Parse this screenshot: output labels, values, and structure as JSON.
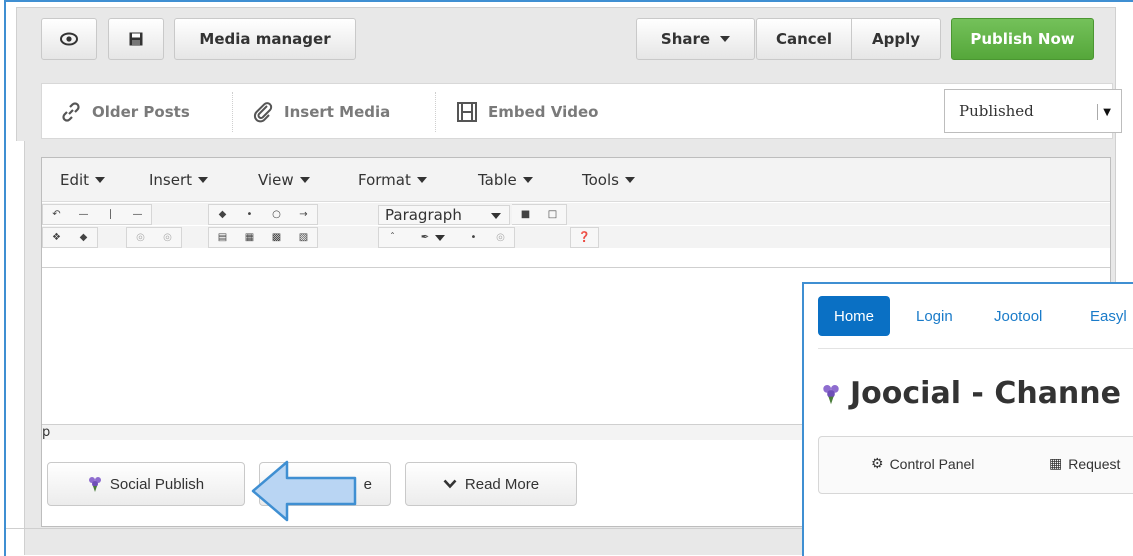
{
  "toolbar": {
    "preview_icon": "eye-icon",
    "save_icon": "floppy-disk-icon",
    "media_manager_label": "Media manager",
    "share_label": "Share",
    "cancel_label": "Cancel",
    "apply_label": "Apply",
    "publish_now_label": "Publish Now"
  },
  "media_bar": {
    "older_posts_label": "Older Posts",
    "insert_media_label": "Insert Media",
    "embed_video_label": "Embed Video",
    "status_value": "Published"
  },
  "editor": {
    "menus": [
      "Edit",
      "Insert",
      "View",
      "Format",
      "Table",
      "Tools"
    ],
    "block_format_value": "Paragraph",
    "statusbar_path": "p"
  },
  "bottom_buttons": {
    "social_publish_label": "Social Publish",
    "pagebreak_label": "e",
    "read_more_label": "Read More"
  },
  "overlay": {
    "nav": {
      "home_label": "Home",
      "login_label": "Login",
      "jootool_label": "Jootool",
      "easy_label": "Easyl"
    },
    "title": "Joocial - Channe",
    "panel": {
      "control_panel_label": "Control Panel",
      "requests_label": "Request"
    }
  },
  "colors": {
    "accent": "#3f8fd2",
    "publish_green": "#5cb040",
    "nav_active": "#0a70c4",
    "link_blue": "#1a7bc9"
  }
}
